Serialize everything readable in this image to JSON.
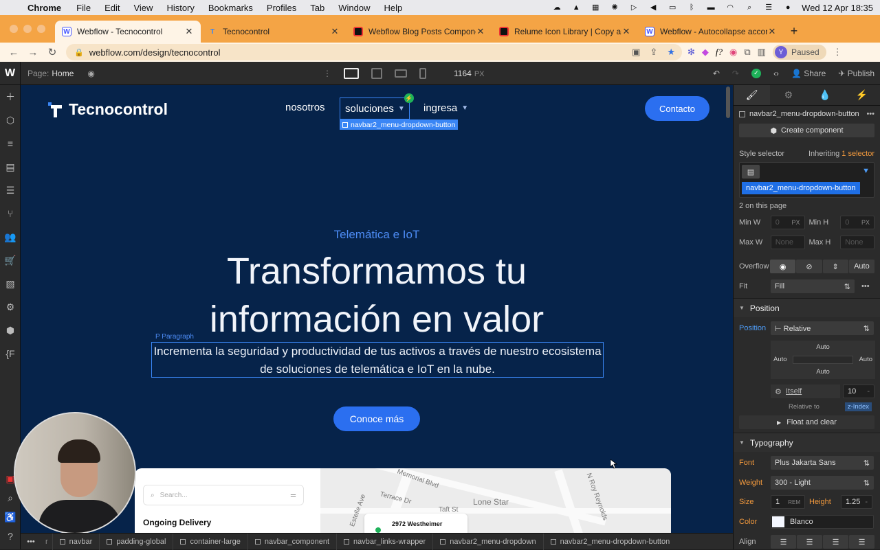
{
  "mac": {
    "app": "Chrome",
    "menus": [
      "File",
      "Edit",
      "View",
      "History",
      "Bookmarks",
      "Profiles",
      "Tab",
      "Window",
      "Help"
    ],
    "datetime": "Wed 12 Apr  18:35"
  },
  "tabs": [
    {
      "title": "Webflow - Tecnocontrol",
      "icon": "webflow-favicon",
      "active": true
    },
    {
      "title": "Tecnocontrol",
      "icon": "tecnocontrol-favicon",
      "active": false
    },
    {
      "title": "Webflow Blog Posts Componen",
      "icon": "relume-favicon",
      "active": false
    },
    {
      "title": "Relume Icon Library | Copy and",
      "icon": "relume-favicon",
      "active": false
    },
    {
      "title": "Webflow - Autocollapse accord",
      "icon": "webflow-favicon",
      "active": false
    }
  ],
  "address": {
    "url": "webflow.com/design/tecnocontrol",
    "profile_initial": "Y",
    "profile_status": "Paused"
  },
  "designer": {
    "page_label": "Page:",
    "page_name": "Home",
    "width_value": "1164",
    "width_unit": "PX",
    "share_label": "Share",
    "publish_label": "Publish"
  },
  "site": {
    "brand": "Tecnocontrol",
    "nav": {
      "nosotros": "nosotros",
      "soluciones": "soluciones",
      "ingresa": "ingresa"
    },
    "selected_tag": "navbar2_menu-dropdown-button",
    "contact_label": "Contacto",
    "kicker": "Telemática e IoT",
    "headline_line1": "Transformamos tu",
    "headline_line2": "información en valor",
    "paragraph_tag": "P  Paragraph",
    "paragraph": "Incrementa la seguridad y productividad de tus activos a través de nuestro ecosistema de soluciones de telemática e IoT en la nube.",
    "cta_label": "Conoce más",
    "mock": {
      "search_placeholder": "Search...",
      "ongoing": "Ongoing Delivery",
      "card_address": "2972 Westheimer",
      "map_labels": [
        "Memorial Blvd",
        "Terrace Dr",
        "Lone Star",
        "Taft St",
        "Estelle Ave",
        "N Roy Reynolds"
      ]
    }
  },
  "breadcrumbs": [
    "navbar",
    "padding-global",
    "container-large",
    "navbar_component",
    "navbar_links-wrapper",
    "navbar2_menu-dropdown",
    "navbar2_menu-dropdown-button"
  ],
  "breadcrumb_partial": "r",
  "panel": {
    "element_name": "navbar2_menu-dropdown-button",
    "create_component": "Create component",
    "style_selector": "Style selector",
    "inheriting": "Inheriting",
    "inheriting_count": "1 selector",
    "class_chip": "navbar2_menu-dropdown-button",
    "on_page": "2 on this page",
    "min_w_label": "Min W",
    "min_w": "0",
    "min_w_unit": "PX",
    "min_h_label": "Min H",
    "min_h": "0",
    "min_h_unit": "PX",
    "max_w_label": "Max W",
    "max_w": "None",
    "max_h_label": "Max H",
    "max_h": "None",
    "overflow_label": "Overflow",
    "overflow_auto": "Auto",
    "fit_label": "Fit",
    "fit_value": "Fill",
    "position_section": "Position",
    "position_label": "Position",
    "position_value": "Relative",
    "pos_top": "Auto",
    "pos_left": "Auto",
    "pos_right": "Auto",
    "pos_bottom": "Auto",
    "itself": "Itself",
    "z_value": "10",
    "relative_to": "Relative to",
    "z_index": "z-Index",
    "float_clear": "Float and clear",
    "typography_section": "Typography",
    "font_label": "Font",
    "font_value": "Plus Jakarta Sans",
    "weight_label": "Weight",
    "weight_value": "300 - Light",
    "size_label": "Size",
    "size_value": "1",
    "size_unit": "REM",
    "height_label": "Height",
    "height_value": "1.25",
    "color_label": "Color",
    "color_value": "Blanco",
    "align_label": "Align"
  }
}
